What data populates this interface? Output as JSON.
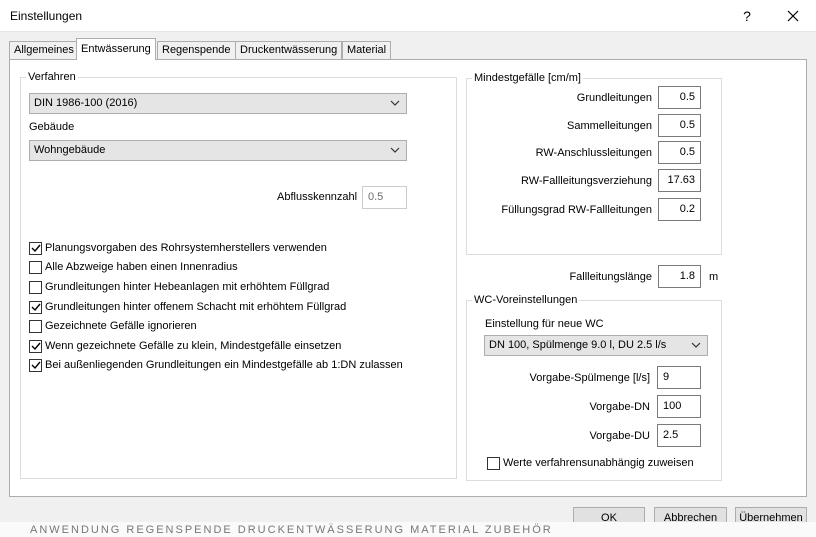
{
  "window": {
    "title": "Einstellungen",
    "help": "?",
    "close": "✕"
  },
  "tabs": [
    {
      "label": "Allgemeines",
      "active": false
    },
    {
      "label": "Entwässerung",
      "active": true
    },
    {
      "label": "Regenspende",
      "active": false
    },
    {
      "label": "Druckentwässerung",
      "active": false
    },
    {
      "label": "Material",
      "active": false
    }
  ],
  "left": {
    "verfahren_label": "Verfahren",
    "verfahren_value": "DIN 1986-100 (2016)",
    "gebaeude_label": "Gebäude",
    "gebaeude_value": "Wohngebäude",
    "abfluss_label": "Abflusskennzahl",
    "abfluss_value": "0.5",
    "checkboxes": [
      {
        "label": "Planungsvorgaben des Rohrsystemherstellers verwenden",
        "checked": true
      },
      {
        "label": "Alle Abzweige haben einen Innenradius",
        "checked": false
      },
      {
        "label": "Grundleitungen hinter Hebeanlagen mit erhöhtem Füllgrad",
        "checked": false
      },
      {
        "label": "Grundleitungen hinter offenem Schacht mit erhöhtem Füllgrad",
        "checked": true
      },
      {
        "label": "Gezeichnete Gefälle ignorieren",
        "checked": false
      },
      {
        "label": "Wenn gezeichnete Gefälle zu klein, Mindestgefälle einsetzen",
        "checked": true
      },
      {
        "label": "Bei außenliegenden Grundleitungen ein Mindestgefälle ab 1:DN zulassen",
        "checked": true
      }
    ]
  },
  "mindest": {
    "title": "Mindestgefälle [cm/m]",
    "rows": [
      {
        "label": "Grundleitungen",
        "value": "0.5"
      },
      {
        "label": "Sammelleitungen",
        "value": "0.5"
      },
      {
        "label": "RW-Anschlussleitungen",
        "value": "0.5"
      },
      {
        "label": "RW-Fallleitungsverziehung",
        "value": "17.63"
      },
      {
        "label": "Füllungsgrad RW-Fallleitungen",
        "value": "0.2"
      }
    ]
  },
  "fall": {
    "label": "Fallleitungslänge",
    "value": "1.8",
    "unit": "m"
  },
  "wc": {
    "title": "WC-Voreinstellungen",
    "neue_label": "Einstellung für neue WC",
    "neue_value": "DN 100, Spülmenge 9.0 l, DU 2.5 l/s",
    "rows": [
      {
        "label": "Vorgabe-Spülmenge [l/s]",
        "value": "9"
      },
      {
        "label": "Vorgabe-DN",
        "value": "100"
      },
      {
        "label": "Vorgabe-DU",
        "value": "2.5"
      }
    ],
    "checkbox": {
      "label": "Werte verfahrensunabhängig zuweisen",
      "checked": false
    }
  },
  "buttons": {
    "ok": "OK",
    "cancel": "Abbrechen",
    "apply": "Übernehmen"
  },
  "background_text": "ANWENDUNG   REGENSPENDE   DRUCKENTWÄSSERUNG   MATERIAL   ZUBEHÖR",
  "colors": {
    "accent": "#0078d7",
    "panel": "#ffffff",
    "dialog": "#f0f0f0"
  }
}
